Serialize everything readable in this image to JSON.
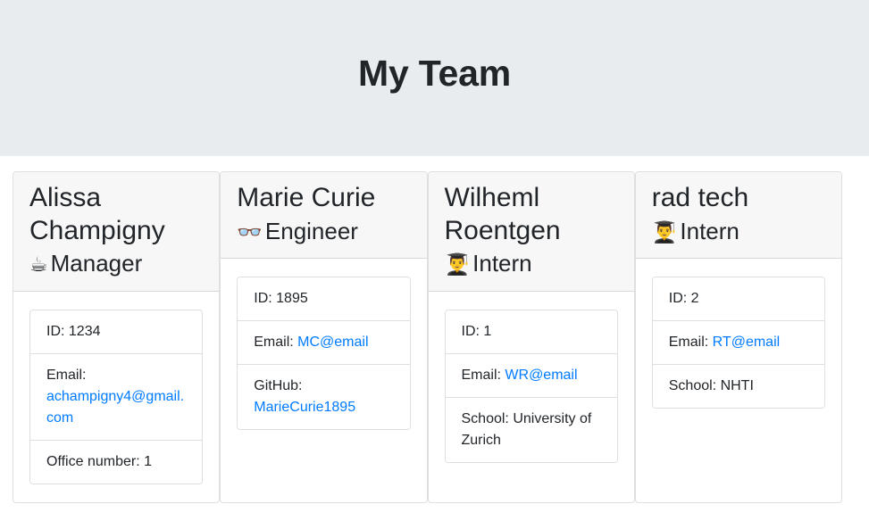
{
  "banner": {
    "title": "My Team"
  },
  "team": [
    {
      "name": "Alissa Champigny",
      "role_icon": "hot-beverage-emoji",
      "role_glyph": "☕",
      "role": "Manager",
      "details": [
        {
          "label": "ID: ",
          "value": "1234",
          "is_link": false
        },
        {
          "label": "Email: ",
          "value": "achampigny4@gmail.com",
          "is_link": true
        },
        {
          "label": "Office number: ",
          "value": "1",
          "is_link": false
        }
      ]
    },
    {
      "name": "Marie Curie",
      "role_icon": "glasses-emoji",
      "role_glyph": "👓",
      "role": "Engineer",
      "details": [
        {
          "label": "ID: ",
          "value": "1895",
          "is_link": false
        },
        {
          "label": "Email: ",
          "value": "MC@email",
          "is_link": true
        },
        {
          "label": "GitHub: ",
          "value": "MarieCurie1895",
          "is_link": true
        }
      ]
    },
    {
      "name": "Wilheml Roentgen",
      "role_icon": "graduate-emoji",
      "role_glyph": "👨‍🎓",
      "role": "Intern",
      "details": [
        {
          "label": "ID: ",
          "value": "1",
          "is_link": false
        },
        {
          "label": "Email: ",
          "value": "WR@email",
          "is_link": true
        },
        {
          "label": "School: ",
          "value": "University of Zurich",
          "is_link": false
        }
      ]
    },
    {
      "name": "rad tech",
      "role_icon": "graduate-emoji",
      "role_glyph": "👨‍🎓",
      "role": "Intern",
      "details": [
        {
          "label": "ID: ",
          "value": "2",
          "is_link": false
        },
        {
          "label": "Email: ",
          "value": "RT@email",
          "is_link": true
        },
        {
          "label": "School: ",
          "value": "NHTI",
          "is_link": false
        }
      ]
    }
  ],
  "colors": {
    "banner_bg": "#e9ecef",
    "card_header_bg": "#f7f7f7",
    "link": "#007bff",
    "text": "#212529",
    "border": "#dddddd"
  }
}
